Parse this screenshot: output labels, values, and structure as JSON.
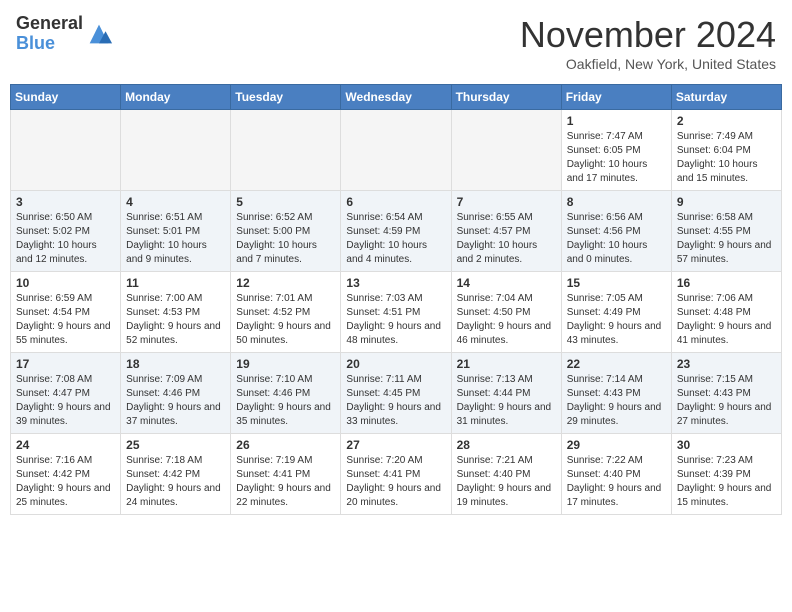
{
  "header": {
    "logo_general": "General",
    "logo_blue": "Blue",
    "month_title": "November 2024",
    "subtitle": "Oakfield, New York, United States"
  },
  "days_of_week": [
    "Sunday",
    "Monday",
    "Tuesday",
    "Wednesday",
    "Thursday",
    "Friday",
    "Saturday"
  ],
  "weeks": [
    [
      {
        "day": "",
        "info": ""
      },
      {
        "day": "",
        "info": ""
      },
      {
        "day": "",
        "info": ""
      },
      {
        "day": "",
        "info": ""
      },
      {
        "day": "",
        "info": ""
      },
      {
        "day": "1",
        "info": "Sunrise: 7:47 AM\nSunset: 6:05 PM\nDaylight: 10 hours and 17 minutes."
      },
      {
        "day": "2",
        "info": "Sunrise: 7:49 AM\nSunset: 6:04 PM\nDaylight: 10 hours and 15 minutes."
      }
    ],
    [
      {
        "day": "3",
        "info": "Sunrise: 6:50 AM\nSunset: 5:02 PM\nDaylight: 10 hours and 12 minutes."
      },
      {
        "day": "4",
        "info": "Sunrise: 6:51 AM\nSunset: 5:01 PM\nDaylight: 10 hours and 9 minutes."
      },
      {
        "day": "5",
        "info": "Sunrise: 6:52 AM\nSunset: 5:00 PM\nDaylight: 10 hours and 7 minutes."
      },
      {
        "day": "6",
        "info": "Sunrise: 6:54 AM\nSunset: 4:59 PM\nDaylight: 10 hours and 4 minutes."
      },
      {
        "day": "7",
        "info": "Sunrise: 6:55 AM\nSunset: 4:57 PM\nDaylight: 10 hours and 2 minutes."
      },
      {
        "day": "8",
        "info": "Sunrise: 6:56 AM\nSunset: 4:56 PM\nDaylight: 10 hours and 0 minutes."
      },
      {
        "day": "9",
        "info": "Sunrise: 6:58 AM\nSunset: 4:55 PM\nDaylight: 9 hours and 57 minutes."
      }
    ],
    [
      {
        "day": "10",
        "info": "Sunrise: 6:59 AM\nSunset: 4:54 PM\nDaylight: 9 hours and 55 minutes."
      },
      {
        "day": "11",
        "info": "Sunrise: 7:00 AM\nSunset: 4:53 PM\nDaylight: 9 hours and 52 minutes."
      },
      {
        "day": "12",
        "info": "Sunrise: 7:01 AM\nSunset: 4:52 PM\nDaylight: 9 hours and 50 minutes."
      },
      {
        "day": "13",
        "info": "Sunrise: 7:03 AM\nSunset: 4:51 PM\nDaylight: 9 hours and 48 minutes."
      },
      {
        "day": "14",
        "info": "Sunrise: 7:04 AM\nSunset: 4:50 PM\nDaylight: 9 hours and 46 minutes."
      },
      {
        "day": "15",
        "info": "Sunrise: 7:05 AM\nSunset: 4:49 PM\nDaylight: 9 hours and 43 minutes."
      },
      {
        "day": "16",
        "info": "Sunrise: 7:06 AM\nSunset: 4:48 PM\nDaylight: 9 hours and 41 minutes."
      }
    ],
    [
      {
        "day": "17",
        "info": "Sunrise: 7:08 AM\nSunset: 4:47 PM\nDaylight: 9 hours and 39 minutes."
      },
      {
        "day": "18",
        "info": "Sunrise: 7:09 AM\nSunset: 4:46 PM\nDaylight: 9 hours and 37 minutes."
      },
      {
        "day": "19",
        "info": "Sunrise: 7:10 AM\nSunset: 4:46 PM\nDaylight: 9 hours and 35 minutes."
      },
      {
        "day": "20",
        "info": "Sunrise: 7:11 AM\nSunset: 4:45 PM\nDaylight: 9 hours and 33 minutes."
      },
      {
        "day": "21",
        "info": "Sunrise: 7:13 AM\nSunset: 4:44 PM\nDaylight: 9 hours and 31 minutes."
      },
      {
        "day": "22",
        "info": "Sunrise: 7:14 AM\nSunset: 4:43 PM\nDaylight: 9 hours and 29 minutes."
      },
      {
        "day": "23",
        "info": "Sunrise: 7:15 AM\nSunset: 4:43 PM\nDaylight: 9 hours and 27 minutes."
      }
    ],
    [
      {
        "day": "24",
        "info": "Sunrise: 7:16 AM\nSunset: 4:42 PM\nDaylight: 9 hours and 25 minutes."
      },
      {
        "day": "25",
        "info": "Sunrise: 7:18 AM\nSunset: 4:42 PM\nDaylight: 9 hours and 24 minutes."
      },
      {
        "day": "26",
        "info": "Sunrise: 7:19 AM\nSunset: 4:41 PM\nDaylight: 9 hours and 22 minutes."
      },
      {
        "day": "27",
        "info": "Sunrise: 7:20 AM\nSunset: 4:41 PM\nDaylight: 9 hours and 20 minutes."
      },
      {
        "day": "28",
        "info": "Sunrise: 7:21 AM\nSunset: 4:40 PM\nDaylight: 9 hours and 19 minutes."
      },
      {
        "day": "29",
        "info": "Sunrise: 7:22 AM\nSunset: 4:40 PM\nDaylight: 9 hours and 17 minutes."
      },
      {
        "day": "30",
        "info": "Sunrise: 7:23 AM\nSunset: 4:39 PM\nDaylight: 9 hours and 15 minutes."
      }
    ]
  ]
}
